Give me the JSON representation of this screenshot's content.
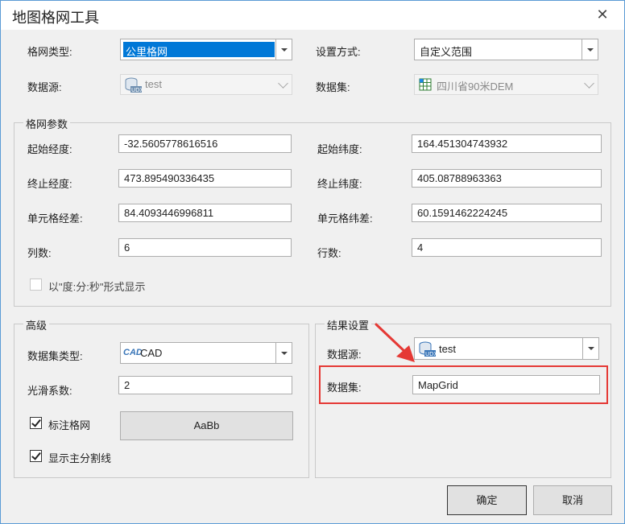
{
  "window": {
    "title": "地图格网工具"
  },
  "top": {
    "grid_type_label": "格网类型:",
    "grid_type_value": "公里格网",
    "datasource_label": "数据源:",
    "datasource_value": "test",
    "setting_label": "设置方式:",
    "setting_value": "自定义范围",
    "dataset_label": "数据集:",
    "dataset_value": "四川省90米DEM"
  },
  "params": {
    "legend": "格网参数",
    "start_lon_label": "起始经度:",
    "start_lon_value": "-32.5605778616516",
    "start_lat_label": "起始纬度:",
    "start_lat_value": "164.451304743932",
    "end_lon_label": "终止经度:",
    "end_lon_value": "473.895490336435",
    "end_lat_label": "终止纬度:",
    "end_lat_value": "405.08788963363",
    "cell_lon_label": "单元格经差:",
    "cell_lon_value": "84.4093446996811",
    "cell_lat_label": "单元格纬差:",
    "cell_lat_value": "60.1591462224245",
    "cols_label": "列数:",
    "cols_value": "6",
    "rows_label": "行数:",
    "rows_value": "4",
    "dms_label": "以\"度:分:秒\"形式显示"
  },
  "advanced": {
    "legend": "高级",
    "dataset_type_label": "数据集类型:",
    "dataset_type_icon_text": "CAD",
    "dataset_type_value": "CAD",
    "smooth_label": "光滑系数:",
    "smooth_value": "2",
    "label_grid": "标注格网",
    "style_preview": "AaBb",
    "show_main_lines": "显示主分割线"
  },
  "result": {
    "legend": "结果设置",
    "datasource_label": "数据源:",
    "datasource_value": "test",
    "dataset_label": "数据集:",
    "dataset_value": "MapGrid"
  },
  "buttons": {
    "ok": "确定",
    "cancel": "取消"
  },
  "colors": {
    "selection": "#0078d7",
    "highlight": "#e53935",
    "border": "#adadad"
  }
}
